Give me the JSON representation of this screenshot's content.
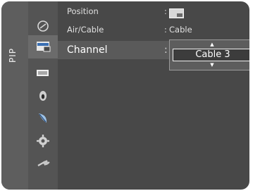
{
  "menu": {
    "title": "PIP",
    "icons": [
      {
        "name": "picture-mode-icon"
      },
      {
        "name": "pip-icon",
        "selected": true
      },
      {
        "name": "screen-icon"
      },
      {
        "name": "sound-icon"
      },
      {
        "name": "channel-antenna-icon"
      },
      {
        "name": "setup-gear-icon"
      },
      {
        "name": "input-plug-icon"
      }
    ],
    "rows": {
      "position": {
        "label": "Position",
        "sep": ":"
      },
      "aircable": {
        "label": "Air/Cable",
        "sep": ":",
        "value": "Cable"
      },
      "channel": {
        "label": "Channel",
        "sep": ":"
      }
    },
    "dropdown": {
      "value": "Cable 3",
      "up_arrow": "▲",
      "down_arrow": "▼"
    }
  }
}
